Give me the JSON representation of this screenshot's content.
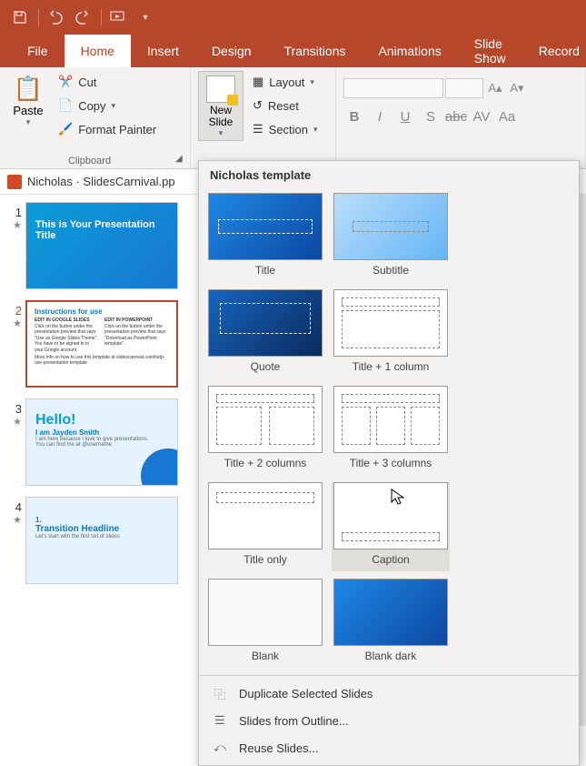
{
  "qat": {
    "save": "save",
    "undo": "undo",
    "redo": "redo",
    "present": "present"
  },
  "tabs": {
    "file": "File",
    "home": "Home",
    "insert": "Insert",
    "design": "Design",
    "transitions": "Transitions",
    "animations": "Animations",
    "slideshow": "Slide Show",
    "record": "Record"
  },
  "clipboard": {
    "paste": "Paste",
    "cut": "Cut",
    "copy": "Copy",
    "format_painter": "Format Painter",
    "group_label": "Clipboard"
  },
  "slides_group": {
    "new_slide": "New Slide",
    "layout": "Layout",
    "reset": "Reset",
    "section": "Section"
  },
  "doc_title": "Nicholas · SlidesCarnival.pp",
  "thumbs": {
    "1": {
      "num": "1",
      "title": "This is Your Presentation Title"
    },
    "2": {
      "num": "2",
      "title": "Instructions for use",
      "h1": "EDIT IN GOOGLE SLIDES",
      "h2": "EDIT IN POWERPOINT",
      "t1": "Click on the button under the presentation preview that says \"Use as Google Slides Theme\".",
      "t2": "Click on the button under the presentation preview that says \"Download as PowerPoint template\".",
      "t3": "You have to be signed in to your Google account.",
      "t4": "More info on how to use this template at slidescarnival.com/help-use-presentation-template"
    },
    "3": {
      "num": "3",
      "title": "Hello!",
      "sub": "I am Jayden Smith",
      "l1": "I am here because I love to give presentations.",
      "l2": "You can find me at @username"
    },
    "4": {
      "num": "4",
      "title": "1.",
      "sub": "Transition Headline",
      "l1": "Let's start with the first set of slides"
    }
  },
  "popup": {
    "header": "Nicholas template",
    "layouts": {
      "title": "Title",
      "subtitle": "Subtitle",
      "quote": "Quote",
      "t1c": "Title + 1 column",
      "t2c": "Title + 2 columns",
      "t3c": "Title + 3 columns",
      "title_only": "Title only",
      "caption": "Caption",
      "blank": "Blank",
      "blank_dark": "Blank dark"
    },
    "menu": {
      "duplicate": "Duplicate Selected Slides",
      "outline": "Slides from Outline...",
      "reuse": "Reuse Slides..."
    }
  }
}
